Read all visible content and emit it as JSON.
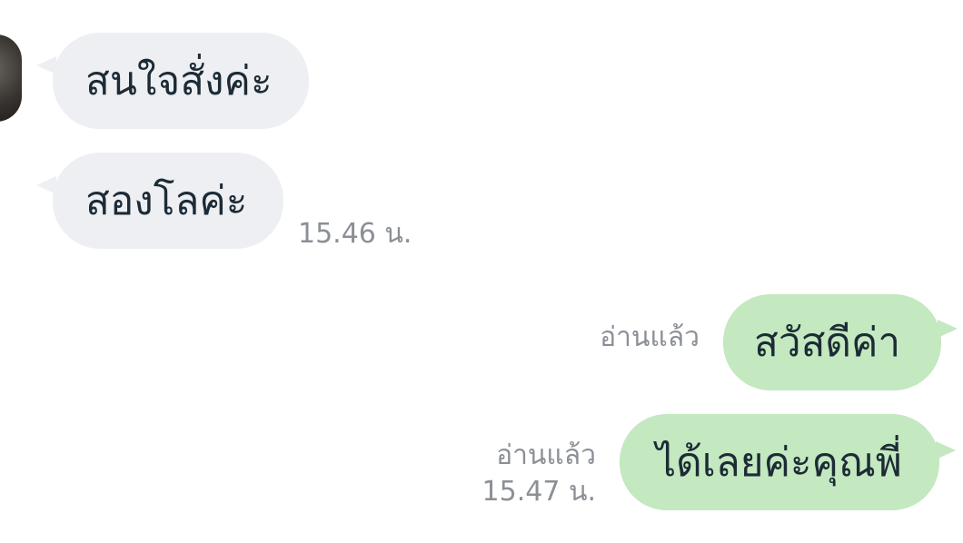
{
  "chat": {
    "incoming": [
      {
        "text": "สนใจสั่งค่ะ"
      },
      {
        "text": "สองโลค่ะ",
        "time": "15.46 น."
      }
    ],
    "outgoing": [
      {
        "text": "สวัสดีค่า",
        "status": "อ่านแล้ว"
      },
      {
        "text": "ได้เลยค่ะคุณพี่",
        "status": "อ่านแล้ว",
        "time": "15.47 น."
      }
    ]
  },
  "colors": {
    "incoming_bubble": "#eeeff2",
    "outgoing_bubble": "#c4e8bf",
    "text": "#1c2b36",
    "meta_text": "#8b8f96"
  }
}
